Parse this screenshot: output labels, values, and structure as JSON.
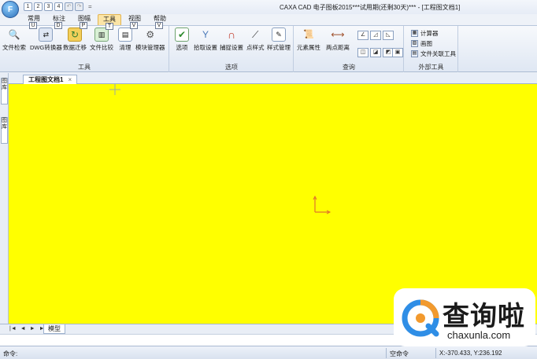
{
  "app": {
    "button_label": "F",
    "title": "CAXA CAD 电子图板2015***试用期(还剩30天)*** - [工程图文档1]"
  },
  "quick_access": {
    "items": [
      "1",
      "2",
      "3",
      "4",
      "",
      ""
    ],
    "more": "="
  },
  "tabs": [
    {
      "label": "常用",
      "keytip": "U"
    },
    {
      "label": "标注",
      "keytip": "D"
    },
    {
      "label": "图幅",
      "keytip": "P"
    },
    {
      "label": "工具",
      "keytip": "T"
    },
    {
      "label": "视图",
      "keytip": "V"
    },
    {
      "label": "帮助",
      "keytip": "V"
    }
  ],
  "ribbon": {
    "tools_group": {
      "label": "工具",
      "buttons": [
        "文件检索",
        "DWG转换器",
        "数据迁移",
        "文件比较",
        "清理",
        "模块管理器"
      ]
    },
    "options_group": {
      "label": "选项",
      "buttons": [
        "选项",
        "拾取设置",
        "捕捉设置",
        "点样式",
        "样式管理"
      ]
    },
    "query_group": {
      "label": "查询",
      "buttons": [
        "元素属性",
        "两点距离"
      ]
    },
    "external_group": {
      "label": "外部工具",
      "items": [
        "计算器",
        "画图",
        "文件关联工具"
      ]
    }
  },
  "left_panel": {
    "tabs": [
      "图库",
      "图库"
    ]
  },
  "document": {
    "tab_label": "工程图文档1",
    "close": "×"
  },
  "model_tabs": {
    "nav": [
      "|◄",
      "◄",
      "►",
      "►|"
    ],
    "active": "模型"
  },
  "status": {
    "command_label": "命令:",
    "state": "空命令",
    "coords": "X:-370.433, Y:236.192"
  },
  "watermark": {
    "text": "查询啦",
    "url": "chaxunla.com"
  },
  "colors": {
    "canvas": "#ffff00",
    "accent": "#fbe4a6",
    "axis": "#e0762b"
  }
}
